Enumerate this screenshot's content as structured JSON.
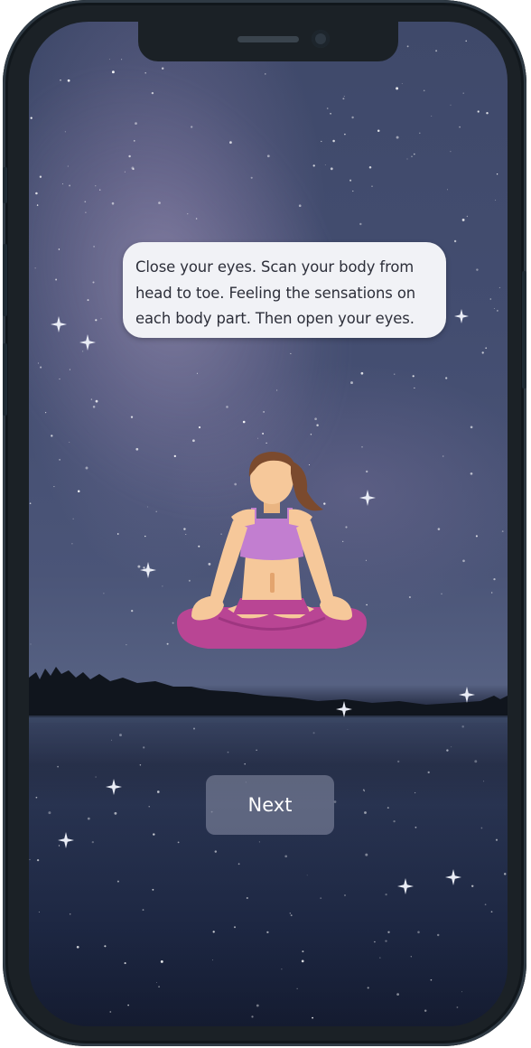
{
  "instruction": {
    "line1": "Close your eyes. Scan your body from",
    "line2": "head to toe. Feeling the sensations on",
    "line3": "each body part. Then open your eyes."
  },
  "actions": {
    "next_label": "Next"
  },
  "colors": {
    "bubble_background": "#f1f2f6",
    "bubble_text": "#2d2f3a",
    "button_background": "#8c91aa",
    "top_color": "#c27ed0",
    "pants_color": "#b94594",
    "skin_color": "#f6c89a",
    "hair_color": "#7b4a2e",
    "device_frame": "#1b2126"
  },
  "icons": {
    "sparkle": "sparkle-icon",
    "figure": "meditation-figure"
  }
}
